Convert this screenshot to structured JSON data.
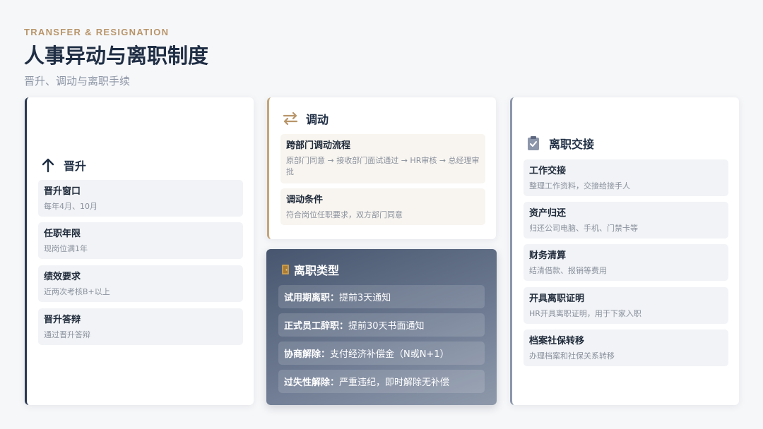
{
  "header": {
    "eyebrow": "TRANSFER & RESIGNATION",
    "title": "人事异动与离职制度",
    "subtitle": "晋升、调动与离职手续"
  },
  "promotion": {
    "icon": "arrow-up-icon",
    "title": "晋升",
    "items": [
      {
        "title": "晋升窗口",
        "desc": "每年4月、10月"
      },
      {
        "title": "任职年限",
        "desc": "现岗位满1年"
      },
      {
        "title": "绩效要求",
        "desc": "近两次考核B+以上"
      },
      {
        "title": "晋升答辩",
        "desc": "通过晋升答辩"
      }
    ]
  },
  "transfer": {
    "icon": "swap-arrows-icon",
    "title": "调动",
    "items": [
      {
        "title": "跨部门调动流程",
        "desc": "原部门同意 → 接收部门面试通过 → HR审核 → 总经理审批"
      },
      {
        "title": "调动条件",
        "desc": "符合岗位任职要求，双方部门同意"
      }
    ]
  },
  "resignation_types": {
    "icon": "door-icon",
    "title": "离职类型",
    "items": [
      {
        "label": "试用期离职：",
        "value": "提前3天通知"
      },
      {
        "label": "正式员工辞职：",
        "value": "提前30天书面通知"
      },
      {
        "label": "协商解除：",
        "value": "支付经济补偿金（N或N+1）"
      },
      {
        "label": "过失性解除：",
        "value": "严重违纪，即时解除无补偿"
      }
    ]
  },
  "handover": {
    "icon": "clipboard-check-icon",
    "title": "离职交接",
    "items": [
      {
        "title": "工作交接",
        "desc": "整理工作资料，交接给接手人"
      },
      {
        "title": "资产归还",
        "desc": "归还公司电脑、手机、门禁卡等"
      },
      {
        "title": "财务清算",
        "desc": "结清借款、报销等费用"
      },
      {
        "title": "开具离职证明",
        "desc": "HR开具离职证明，用于下家入职"
      },
      {
        "title": "档案社保转移",
        "desc": "办理档案和社保关系转移"
      }
    ]
  },
  "colors": {
    "accent_gold": "#b8956a",
    "navy": "#2b3a52",
    "slate": "#8c96aa"
  }
}
